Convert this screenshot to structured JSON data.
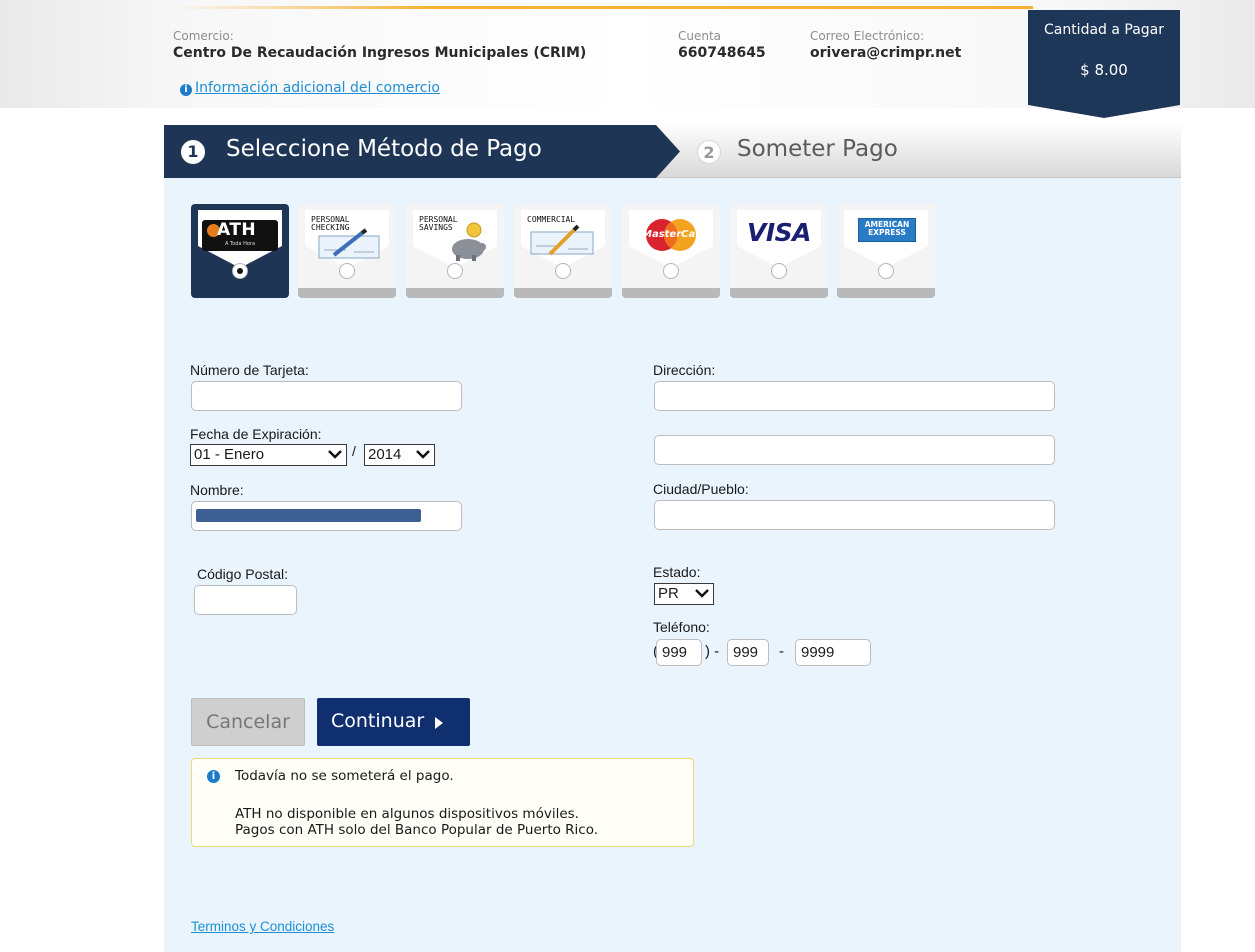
{
  "merchant": {
    "merchant_label": "Comercio:",
    "merchant_name": "Centro De Recaudación Ingresos Municipales (CRIM)",
    "account_label": "Cuenta",
    "account_number": "660748645",
    "email_label": "Correo Electrónico:",
    "email": "orivera@crimpr.net",
    "info_link": "Información adicional del comercio"
  },
  "amount": {
    "label": "Cantidad a Pagar",
    "value": "$ 8.00"
  },
  "steps": [
    {
      "number": "1",
      "label": "Seleccione Método de Pago"
    },
    {
      "number": "2",
      "label": "Someter Pago"
    }
  ],
  "payment_methods": [
    {
      "id": "ath",
      "icon": "ath-card-icon",
      "text": "ATH",
      "subtext": "A Toda Hora",
      "selected": true
    },
    {
      "id": "personal-checking",
      "icon": "personal-checking-icon",
      "text": "PERSONAL CHECKING",
      "selected": false
    },
    {
      "id": "personal-savings",
      "icon": "personal-savings-icon",
      "text": "PERSONAL SAVINGS",
      "selected": false
    },
    {
      "id": "commercial",
      "icon": "commercial-check-icon",
      "text": "COMMERCIAL",
      "selected": false
    },
    {
      "id": "mastercard",
      "icon": "mastercard-icon",
      "text": "MasterCard",
      "selected": false
    },
    {
      "id": "visa",
      "icon": "visa-icon",
      "text": "VISA",
      "selected": false
    },
    {
      "id": "amex",
      "icon": "american-express-icon",
      "text": "AMERICAN EXPRESS",
      "selected": false
    }
  ],
  "form": {
    "card_number_label": "Número de Tarjeta:",
    "card_number_value": "",
    "expiration_label": "Fecha de Expiración:",
    "exp_month": "01 - Enero",
    "exp_separator": "/",
    "exp_year": "2014",
    "name_label": "Nombre:",
    "postal_label": "Código Postal:",
    "postal_value": "",
    "address_label": "Dirección:",
    "address_line1": "",
    "address_line2": "",
    "city_label": "Ciudad/Pueblo:",
    "city_value": "",
    "state_label": "Estado:",
    "state_value": "PR",
    "phone_label": "Teléfono:",
    "phone_area": "999",
    "phone_prefix": "999",
    "phone_line": "9999",
    "phone_open": "(",
    "phone_close": ") -",
    "phone_dash": "-"
  },
  "buttons": {
    "cancel": "Cancelar",
    "continue": "Continuar"
  },
  "notice": {
    "line1": "Todavía no se someterá el pago.",
    "line2": "ATH no disponible en algunos dispositivos móviles.",
    "line3": "Pagos con ATH solo del Banco Popular de Puerto Rico."
  },
  "footer": {
    "terms": "Terminos y Condiciones"
  },
  "colors": {
    "header_navy": "#1f3555",
    "continue_button": "#0f2f6e",
    "link_blue": "#1d8fd4",
    "panel_bg": "#eaf4fd",
    "accent_gold": "#f5b233"
  }
}
